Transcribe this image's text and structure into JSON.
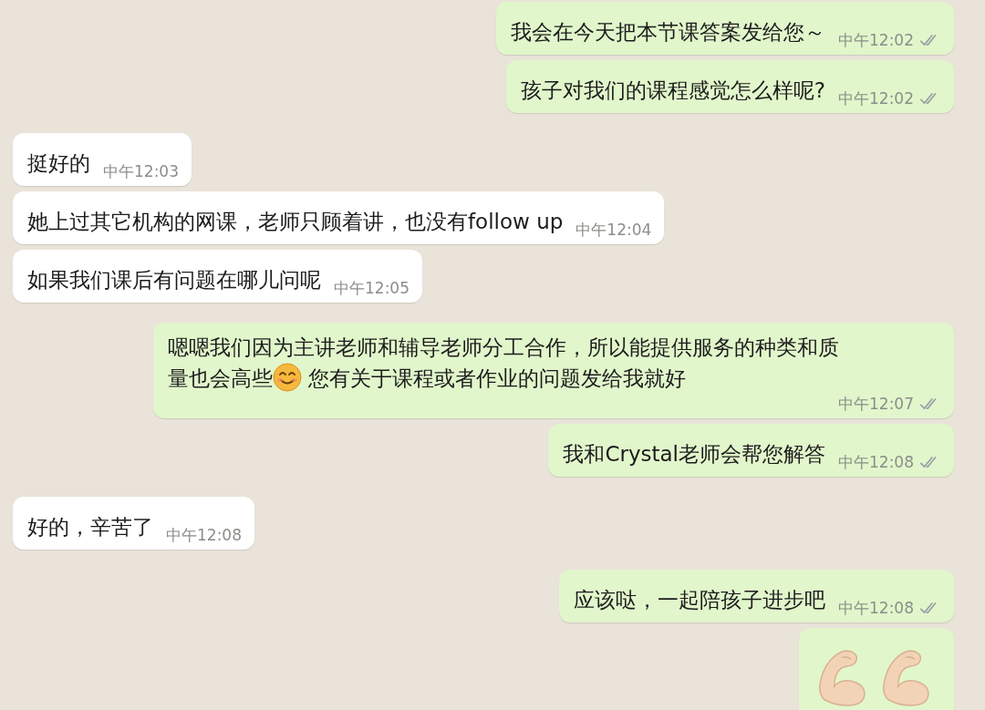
{
  "messages": [
    {
      "outgoing": true,
      "segments": [
        {
          "kind": "text",
          "text": "我会在今天把本节课答案发给您～"
        }
      ],
      "time": "中午12:02",
      "read": false
    },
    {
      "outgoing": true,
      "segments": [
        {
          "kind": "text",
          "text": "孩子对我们的课程感觉怎么样呢?"
        }
      ],
      "time": "中午12:02",
      "read": false
    },
    {
      "outgoing": false,
      "segments": [
        {
          "kind": "text",
          "text": "挺好的"
        }
      ],
      "time": "中午12:03"
    },
    {
      "outgoing": false,
      "segments": [
        {
          "kind": "text",
          "text": "她上过其它机构的网课，老师只顾着讲，也没有follow up"
        }
      ],
      "time": "中午12:04"
    },
    {
      "outgoing": false,
      "segments": [
        {
          "kind": "text",
          "text": "如果我们课后有问题在哪儿问呢"
        }
      ],
      "time": "中午12:05"
    },
    {
      "outgoing": true,
      "segments": [
        {
          "kind": "line",
          "text": "嗯嗯我们因为主讲老师和辅导老师分工合作，所以能提供服务的种类和质"
        },
        {
          "kind": "text",
          "text": "量也会高些"
        },
        {
          "kind": "smile"
        },
        {
          "kind": "text",
          "text": " 您有关于课程或者作业的问题发给我就好"
        }
      ],
      "time": "中午12:07",
      "read": false
    },
    {
      "outgoing": true,
      "segments": [
        {
          "kind": "text",
          "text": "我和Crystal老师会帮您解答"
        }
      ],
      "time": "中午12:08",
      "read": false
    },
    {
      "outgoing": false,
      "segments": [
        {
          "kind": "text",
          "text": "好的，辛苦了"
        }
      ],
      "time": "中午12:08"
    },
    {
      "outgoing": true,
      "segments": [
        {
          "kind": "text",
          "text": "应该哒，一起陪孩子进步吧"
        }
      ],
      "time": "中午12:08",
      "read": false
    },
    {
      "outgoing": true,
      "segments": [
        {
          "kind": "muscle"
        },
        {
          "kind": "muscle"
        }
      ]
    }
  ]
}
